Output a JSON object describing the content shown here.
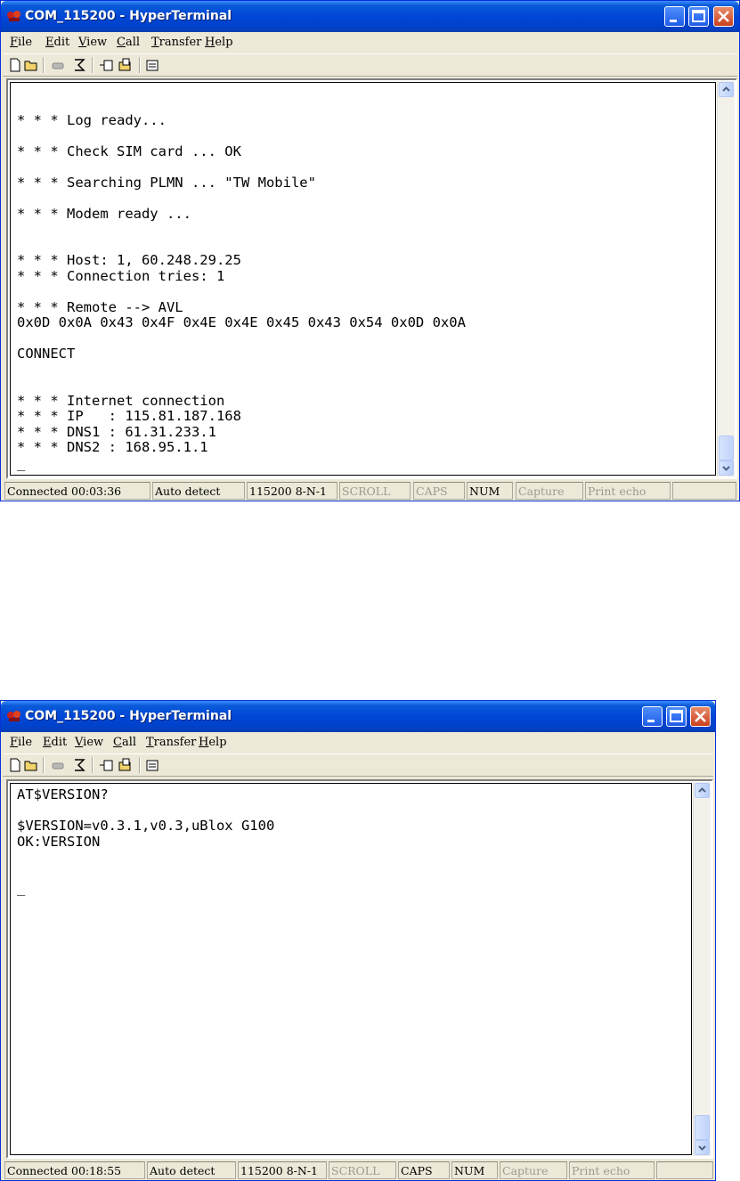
{
  "windows": [
    {
      "title": "COM_115200 - HyperTerminal",
      "menu": [
        "File",
        "Edit",
        "View",
        "Call",
        "Transfer",
        "Help"
      ],
      "terminal_text": "\n* * * Log ready...\n\n* * * Check SIM card ... OK\n\n* * * Searching PLMN ... \"TW Mobile\"\n\n* * * Modem ready ...\n\n\n* * * Host: 1, 60.248.29.25\n* * * Connection tries: 1\n\n* * * Remote --> AVL\n0x0D 0x0A 0x43 0x4F 0x4E 0x4E 0x45 0x43 0x54 0x0D 0x0A\n\nCONNECT\n\n\n* * * Internet connection\n* * * IP   : 115.81.187.168\n* * * DNS1 : 61.31.233.1\n* * * DNS2 : 168.95.1.1\n_",
      "status": {
        "connected": "Connected 00:03:36",
        "detect": "Auto detect",
        "port": "115200 8-N-1",
        "scroll": "SCROLL",
        "caps": "CAPS",
        "num": "NUM",
        "capture": "Capture",
        "print_echo": "Print echo"
      }
    },
    {
      "title": "COM_115200 - HyperTerminal",
      "menu": [
        "File",
        "Edit",
        "View",
        "Call",
        "Transfer",
        "Help"
      ],
      "terminal_text": "AT$VERSION?\n\n$VERSION=v0.3.1,v0.3,uBlox G100\nOK:VERSION\n\n\n_",
      "status": {
        "connected": "Connected 00:18:55",
        "detect": "Auto detect",
        "port": "115200 8-N-1",
        "scroll": "SCROLL",
        "caps": "CAPS",
        "num": "NUM",
        "capture": "Capture",
        "print_echo": "Print echo"
      }
    }
  ],
  "icons": [
    "hyperterminal-app-icon",
    "minimize-icon",
    "maximize-icon",
    "close-icon",
    "new-icon",
    "open-icon",
    "disconnect-icon",
    "dial-icon",
    "send-icon",
    "receive-icon",
    "properties-icon",
    "scroll-up-icon",
    "scroll-down-icon"
  ]
}
